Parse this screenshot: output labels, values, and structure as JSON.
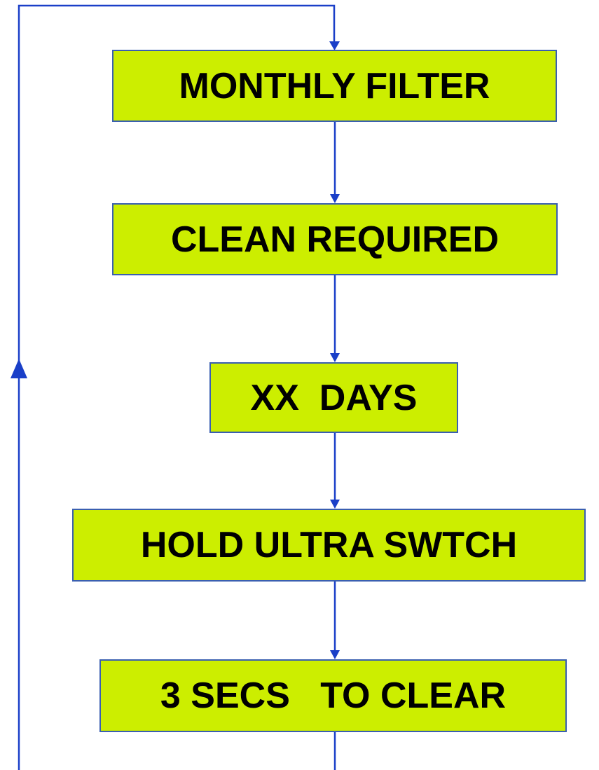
{
  "colors": {
    "box_fill": "#ccee00",
    "box_border": "#3a5fb0",
    "arrow": "#1a3fc8",
    "text": "#000000"
  },
  "steps": [
    {
      "label": "MONTHLY FILTER"
    },
    {
      "label": "CLEAN REQUIRED"
    },
    {
      "label": "XX  DAYS"
    },
    {
      "label": "HOLD ULTRA SWTCH"
    },
    {
      "label": "3 SECS   TO CLEAR"
    }
  ]
}
